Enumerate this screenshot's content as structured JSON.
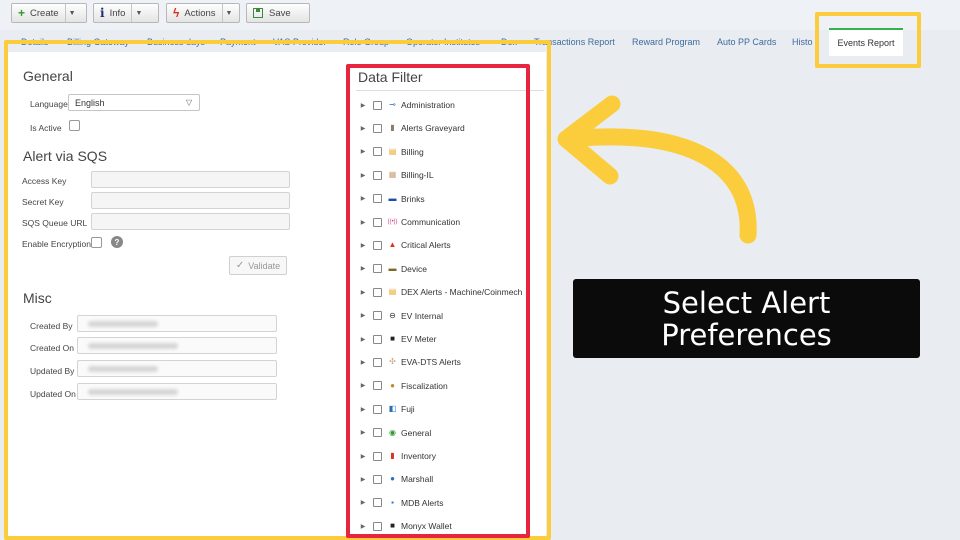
{
  "toolbar": {
    "create_label": "Create",
    "info_label": "Info",
    "actions_label": "Actions",
    "save_label": "Save"
  },
  "tabs": [
    {
      "label": "Details"
    },
    {
      "label": "Billing Gateway"
    },
    {
      "label": "Business days"
    },
    {
      "label": "Payment"
    },
    {
      "label": "VAS Provider"
    },
    {
      "label": "Role Group"
    },
    {
      "label": "Operator Institutes"
    },
    {
      "label": "Dex"
    },
    {
      "label": "Transactions Report"
    },
    {
      "label": "Reward Program"
    },
    {
      "label": "Auto PP Cards"
    },
    {
      "label": "Histo"
    }
  ],
  "active_tab": {
    "label": "Events Report"
  },
  "general": {
    "title": "General",
    "language_label": "Language",
    "language_value": "English",
    "is_active_label": "Is Active"
  },
  "sqs": {
    "title": "Alert via SQS",
    "access_key_label": "Access Key",
    "secret_key_label": "Secret Key",
    "queue_url_label": "SQS Queue URL",
    "encryption_label": "Enable Encryption",
    "validate_label": "Validate"
  },
  "misc": {
    "title": "Misc",
    "created_by_label": "Created By",
    "created_on_label": "Created On",
    "updated_by_label": "Updated By",
    "updated_on_label": "Updated On"
  },
  "data_filter": {
    "title": "Data Filter",
    "items": [
      {
        "label": "Administration",
        "icon": "key-icon"
      },
      {
        "label": "Alerts Graveyard",
        "icon": "tombstone-icon"
      },
      {
        "label": "Billing",
        "icon": "billing-icon"
      },
      {
        "label": "Billing-IL",
        "icon": "calculator-icon"
      },
      {
        "label": "Brinks",
        "icon": "brinks-icon"
      },
      {
        "label": "Communication",
        "icon": "signal-icon"
      },
      {
        "label": "Critical Alerts",
        "icon": "warning-icon"
      },
      {
        "label": "Device",
        "icon": "device-icon"
      },
      {
        "label": "DEX Alerts - Machine/Coinmech",
        "icon": "dex-icon"
      },
      {
        "label": "EV Internal",
        "icon": "ev-icon"
      },
      {
        "label": "EV Meter",
        "icon": "ev-meter-icon"
      },
      {
        "label": "EVA-DTS Alerts",
        "icon": "eva-icon"
      },
      {
        "label": "Fiscalization",
        "icon": "fiscal-icon"
      },
      {
        "label": "Fuji",
        "icon": "fuji-icon"
      },
      {
        "label": "General",
        "icon": "circle-icon"
      },
      {
        "label": "Inventory",
        "icon": "inventory-icon"
      },
      {
        "label": "Marshall",
        "icon": "globe-icon"
      },
      {
        "label": "MDB Alerts",
        "icon": "mdb-icon"
      },
      {
        "label": "Monyx Wallet",
        "icon": "wallet-icon"
      }
    ]
  },
  "callout": {
    "line1": "Select Alert",
    "line2": "Preferences"
  },
  "colors": {
    "highlight_yellow": "#fbcc3c",
    "highlight_red": "#e8253f",
    "active_tab_green": "#36b24a",
    "link_blue": "#3f6a9c"
  }
}
